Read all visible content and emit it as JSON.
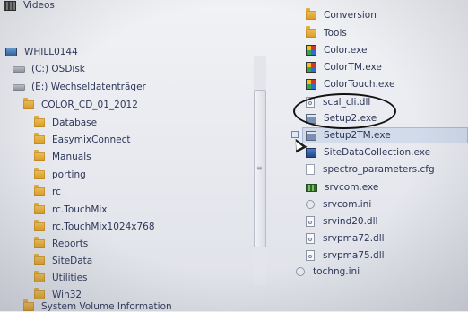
{
  "left_pane": {
    "videos": "Videos",
    "computer": "WHILL0144",
    "drive_c": "(C:) OSDisk",
    "drive_e": "(E:) Wechseldatenträger",
    "root_folder": "COLOR_CD_01_2012",
    "subfolders": [
      "Database",
      "EasymixConnect",
      "Manuals",
      "porting",
      "rc",
      "rc.TouchMix",
      "rc.TouchMix1024x768",
      "Reports",
      "SiteData",
      "Utilities",
      "Win32"
    ],
    "system_volume": "System Volume Information"
  },
  "right_pane": {
    "folders": [
      "Conversion",
      "Tools"
    ],
    "files": [
      {
        "name": "Color.exe",
        "icon": "color-exe-icon"
      },
      {
        "name": "ColorTM.exe",
        "icon": "color-exe-icon"
      },
      {
        "name": "ColorTouch.exe",
        "icon": "color-exe-icon"
      },
      {
        "name": "scal_cli.dll",
        "icon": "dll-file-icon"
      },
      {
        "name": "Setup2.exe",
        "icon": "setup-exe-icon"
      },
      {
        "name": "Setup2TM.exe",
        "icon": "setup-exe-icon"
      },
      {
        "name": "SiteDataCollection.exe",
        "icon": "blue-exe-icon"
      },
      {
        "name": "spectro_parameters.cfg",
        "icon": "document-icon"
      },
      {
        "name": "srvcom.exe",
        "icon": "green-exe-icon"
      },
      {
        "name": "srvcom.ini",
        "icon": "ini-file-icon"
      },
      {
        "name": "srvind20.dll",
        "icon": "dll-file-icon"
      },
      {
        "name": "srvpma72.dll",
        "icon": "dll-file-icon"
      },
      {
        "name": "srvpma75.dll",
        "icon": "dll-file-icon"
      },
      {
        "name": "tochng.ini",
        "icon": "ini-file-icon"
      }
    ]
  },
  "scrollbar_grip": "≡"
}
